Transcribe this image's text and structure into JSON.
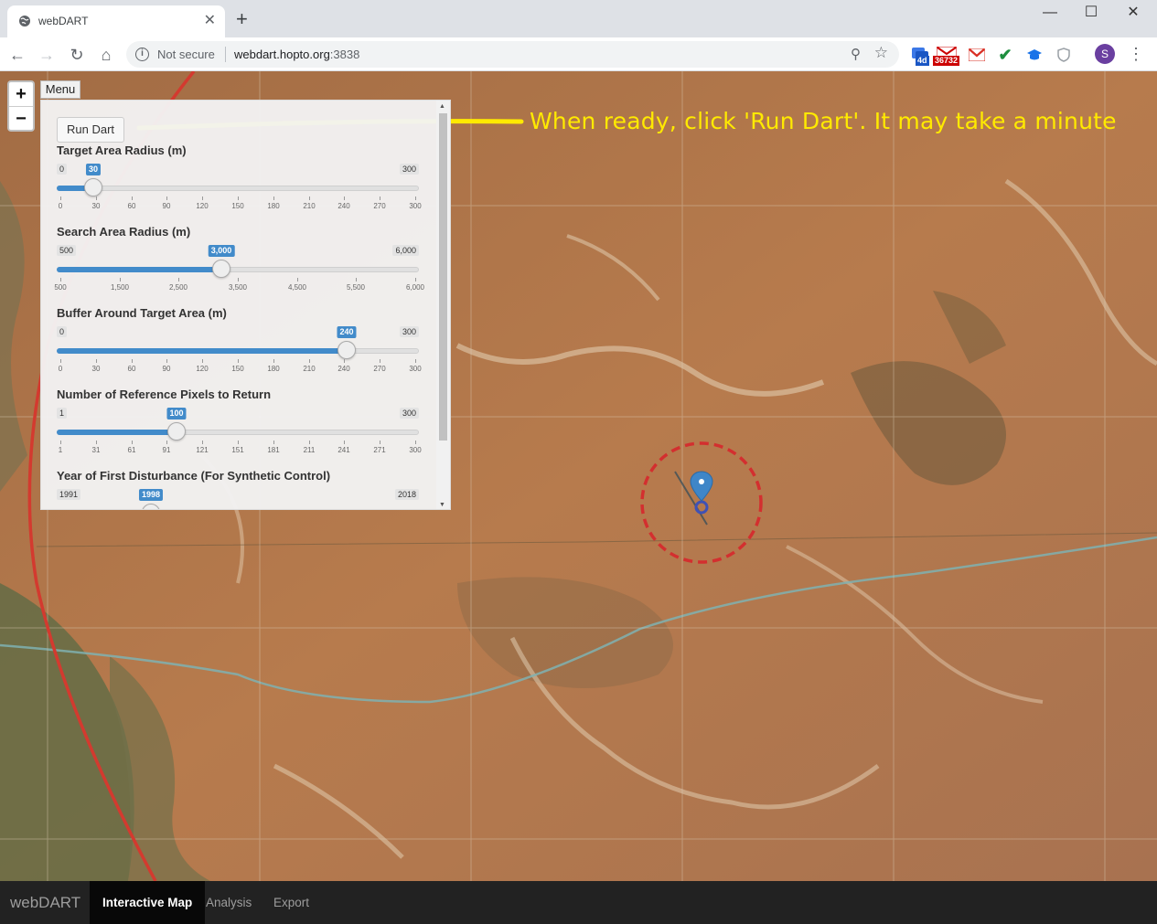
{
  "browser": {
    "tab_title": "webDART",
    "tab_close": "✕",
    "new_tab": "+",
    "window_controls": [
      "—",
      "☐",
      "✕"
    ],
    "security_label": "Not secure",
    "url_host": "webdart.hopto.org",
    "url_port": ":3838",
    "extension_badges": {
      "ext1": "4d",
      "ext2": "36732"
    },
    "profile_initial": "S",
    "nav_icons": [
      "back-arrow-icon",
      "forward-arrow-icon",
      "reload-icon",
      "home-icon"
    ]
  },
  "map": {
    "zoom_in": "+",
    "zoom_out": "−",
    "menu_label": "Menu",
    "annotation": "When ready, click 'Run Dart'. It may take a minute"
  },
  "panel": {
    "run_button": "Run Dart",
    "sliders": [
      {
        "label": "Target Area Radius (m)",
        "min": "0",
        "max": "300",
        "value": "30",
        "fraction": 0.1,
        "ticks": [
          "0",
          "30",
          "60",
          "90",
          "120",
          "150",
          "180",
          "210",
          "240",
          "270",
          "300"
        ]
      },
      {
        "label": "Search Area Radius (m)",
        "min": "500",
        "max": "6,000",
        "value": "3,000",
        "fraction": 0.4545,
        "ticks": [
          "500",
          "1,500",
          "2,500",
          "3,500",
          "4,500",
          "5,500",
          "6,000"
        ]
      },
      {
        "label": "Buffer Around Target Area (m)",
        "min": "0",
        "max": "300",
        "value": "240",
        "fraction": 0.8,
        "ticks": [
          "0",
          "30",
          "60",
          "90",
          "120",
          "150",
          "180",
          "210",
          "240",
          "270",
          "300"
        ]
      },
      {
        "label": "Number of Reference Pixels to Return",
        "min": "1",
        "max": "300",
        "value": "100",
        "fraction": 0.331,
        "ticks": [
          "1",
          "31",
          "61",
          "91",
          "121",
          "151",
          "181",
          "211",
          "241",
          "271",
          "300"
        ]
      },
      {
        "label": "Year of First Disturbance (For Synthetic Control)",
        "min": "1991",
        "max": "2018",
        "value": "1998",
        "fraction": 0.259,
        "ticks": []
      }
    ]
  },
  "navbar": {
    "brand": "webDART",
    "items": [
      "Interactive Map",
      "Analysis",
      "Export"
    ],
    "active_index": 0
  },
  "colors": {
    "slider_fill": "#428bca",
    "annotation": "#ffea00",
    "circle": "#d32f2f",
    "marker": "#3f86c8"
  }
}
